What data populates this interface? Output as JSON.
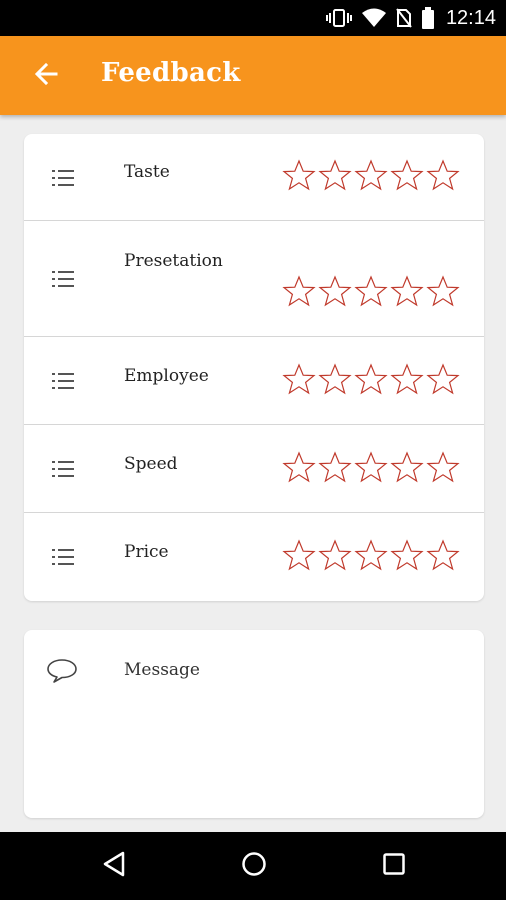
{
  "status_bar": {
    "time": "12:14",
    "icons": [
      "vibrate-icon",
      "wifi-icon",
      "no-sim-icon",
      "battery-icon"
    ]
  },
  "app_bar": {
    "title": "Feedback",
    "back_icon": "arrow-left-icon",
    "color": "#f7941d"
  },
  "ratings": [
    {
      "label": "Taste",
      "stars": 0,
      "max": 5
    },
    {
      "label": "Presetation",
      "stars": 0,
      "max": 5
    },
    {
      "label": "Employee",
      "stars": 0,
      "max": 5
    },
    {
      "label": "Speed",
      "stars": 0,
      "max": 5
    },
    {
      "label": "Price",
      "stars": 0,
      "max": 5
    }
  ],
  "star_color": "#c0392b",
  "message": {
    "placeholder": "Message",
    "value": ""
  },
  "nav_bar": {
    "icons": [
      "back-triangle-icon",
      "home-circle-icon",
      "recents-square-icon"
    ]
  }
}
